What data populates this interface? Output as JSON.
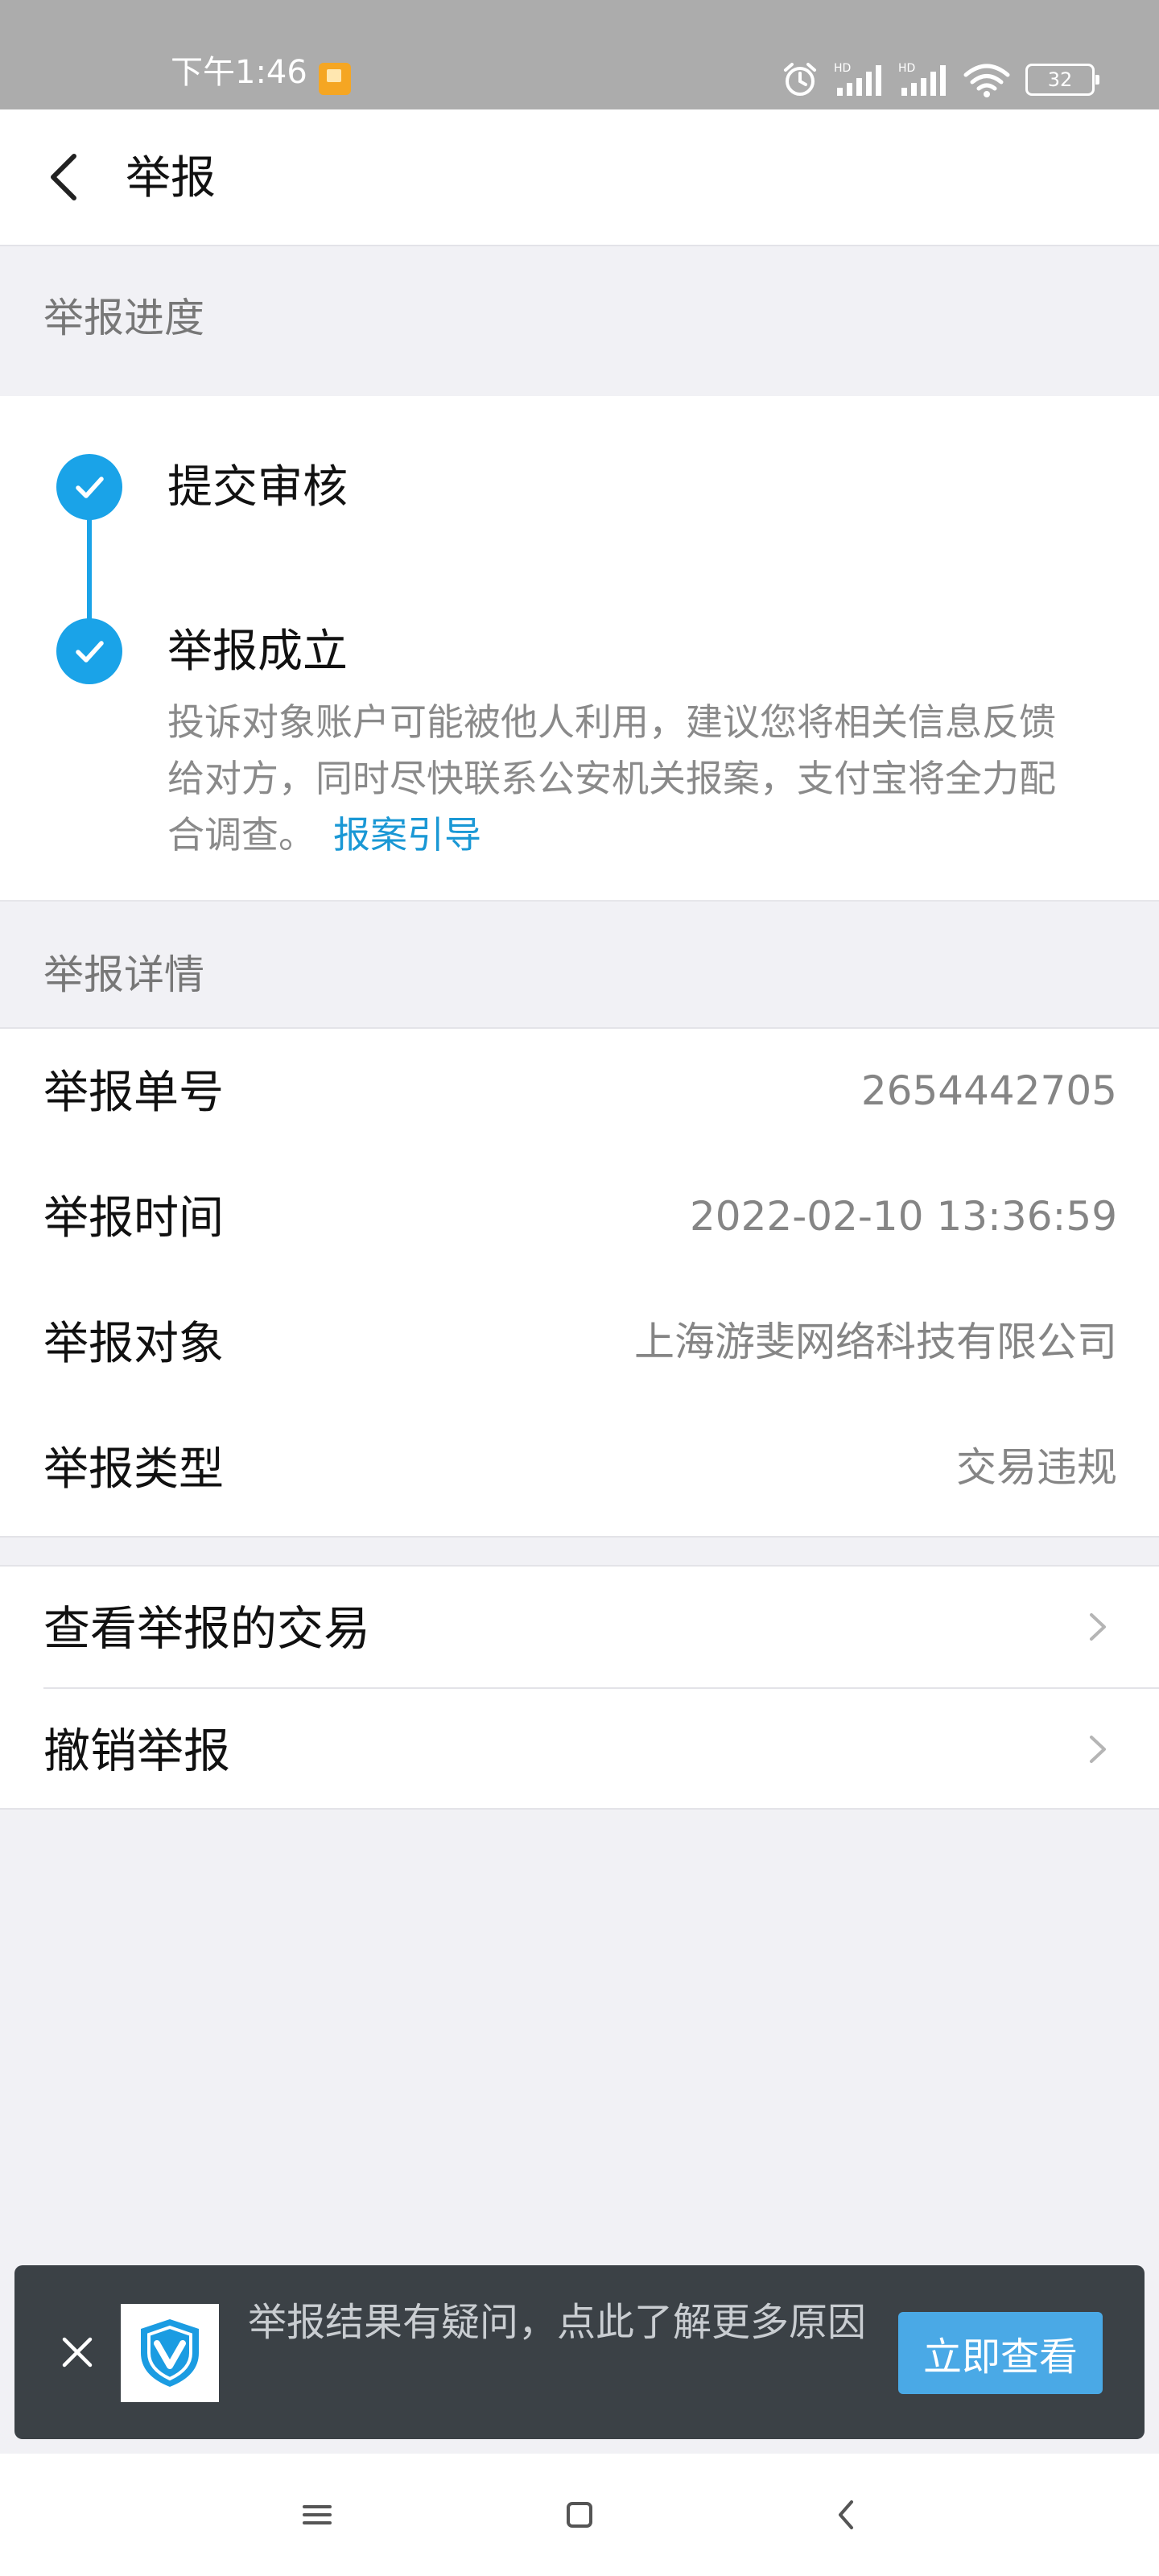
{
  "status_bar": {
    "time": "下午1:46",
    "battery": "32"
  },
  "header": {
    "title": "举报"
  },
  "progress_section": {
    "title": "举报进度",
    "steps": [
      {
        "title": "提交审核"
      },
      {
        "title": "举报成立",
        "description": "投诉对象账户可能被他人利用，建议您将相关信息反馈给对方，同时尽快联系公安机关报案，支付宝将全力配合调查。",
        "link": "报案引导"
      }
    ]
  },
  "details_section": {
    "title": "举报详情",
    "rows": [
      {
        "label": "举报单号",
        "value": "2654442705"
      },
      {
        "label": "举报时间",
        "value": "2022-02-10 13:36:59"
      },
      {
        "label": "举报对象",
        "value": "上海游斐网络科技有限公司"
      },
      {
        "label": "举报类型",
        "value": "交易违规"
      }
    ]
  },
  "actions": [
    {
      "label": "查看举报的交易"
    },
    {
      "label": "撤销举报"
    }
  ],
  "banner": {
    "text": "举报结果有疑问，点此了解更多原因",
    "button": "立即查看"
  },
  "colors": {
    "accent": "#1aa3e8",
    "link": "#1a98d5",
    "banner_bg": "#3b4146",
    "banner_button": "#4aa9e6"
  }
}
